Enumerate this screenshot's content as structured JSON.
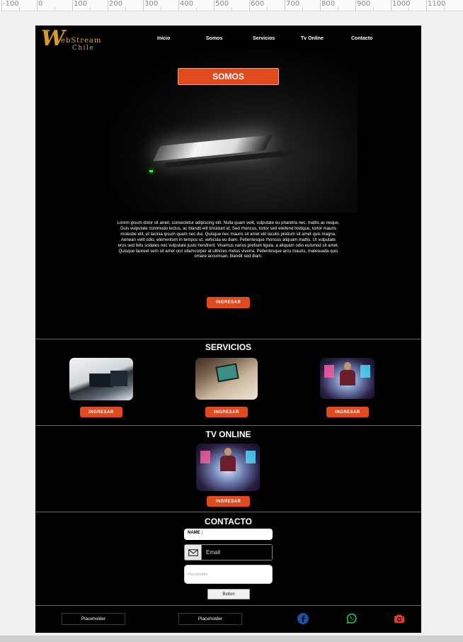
{
  "ruler": {
    "labels": [
      "-100",
      "0",
      "100",
      "200",
      "300",
      "400",
      "500",
      "600",
      "700",
      "800",
      "900",
      "1000",
      "1100"
    ]
  },
  "header": {
    "logo_line1": "ebStream",
    "logo_line2": "Chile",
    "logo_mark": "W",
    "nav": [
      "Inicio",
      "Somos",
      "Servicios",
      "Tv Online",
      "Contacto"
    ]
  },
  "hero": {
    "title": "SOMOS",
    "body": "Lorem ipsum dolor sit amet, consectetur adipiscing elit. Nulla quam velit, vulputate eu pharetra nec, mattis ac neque. Duis vulputate commodo lectus, ac blandit elit tincidunt id. Sed rhoncus, tortor sed eleifend tristique, tortor mauris molestie elit, et lacinia ipsum quam nec dui. Quisque nec mauris sit amet elit iaculis pretium sit amet quis magna. Aenean velit odio, elementum in tempus ut, vehicula eu diam. Pellentesque rhoncus aliquam mattis. Ut vulputate eros sed felis sodales nec vulputate justo hendrerit. Vivamus varius pretium ligula, a aliquam odio euismod sit amet. Quisque laoreet sem sit amet orci ullamcorper at ultricies metus viverra. Pellentesque arcu mauris, malesuada quis ornare accumsan, blandit sed diam.",
    "cta": "INGRESAR"
  },
  "servicios": {
    "title": "SERVICIOS",
    "items": [
      {
        "cta": "INGRESAR"
      },
      {
        "cta": "INGRESAR"
      },
      {
        "cta": "INGRESAR"
      }
    ]
  },
  "tv": {
    "title": "TV ONLINE",
    "cta": "INGRESAR"
  },
  "contacto": {
    "title": "CONTACTO",
    "name_label": "NAME :",
    "email_placeholder": "Email",
    "textarea_placeholder": "Placeholder",
    "button": "Button"
  },
  "footer": {
    "box1": "Placeholder",
    "box2": "Placeholder",
    "icons": [
      "facebook-icon",
      "whatsapp-icon",
      "camera-icon"
    ]
  },
  "colors": {
    "accent": "#e04a1f",
    "facebook": "#1b4fa8",
    "whatsapp": "#25d366",
    "camera": "#e53935",
    "logo": "#d89b2a"
  }
}
